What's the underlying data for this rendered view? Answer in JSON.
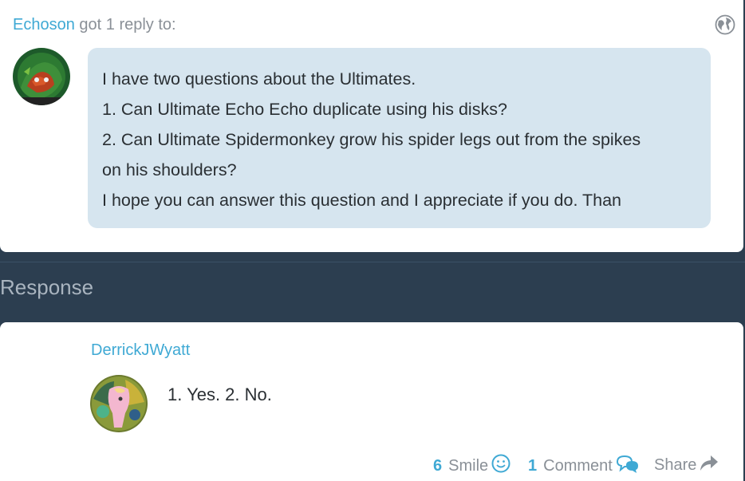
{
  "question": {
    "username": "Echoson",
    "header_suffix": "got 1 reply to:",
    "lines": [
      "I have two questions about the Ultimates.",
      "1. Can Ultimate Echo Echo duplicate using his disks?",
      "2. Can Ultimate Spidermonkey grow his spider legs out from the spikes",
      "on his shoulders?",
      "I hope you can answer this question and I appreciate if you do. Than"
    ]
  },
  "response": {
    "section_title": "Response",
    "username": "DerrickJWyatt",
    "text": "1. Yes. 2. No."
  },
  "actions": {
    "smile_count": "6",
    "smile_label": "Smile",
    "comment_count": "1",
    "comment_label": "Comment",
    "share_label": "Share"
  },
  "colors": {
    "accent": "#3fa9d4",
    "muted": "#8a9097",
    "bubble": "#d6e5ef",
    "background": "#2c3e50"
  },
  "icons": {
    "globe": "globe-icon",
    "smile": "smile-icon",
    "comment": "comment-bubbles-icon",
    "share": "share-arrow-icon"
  }
}
